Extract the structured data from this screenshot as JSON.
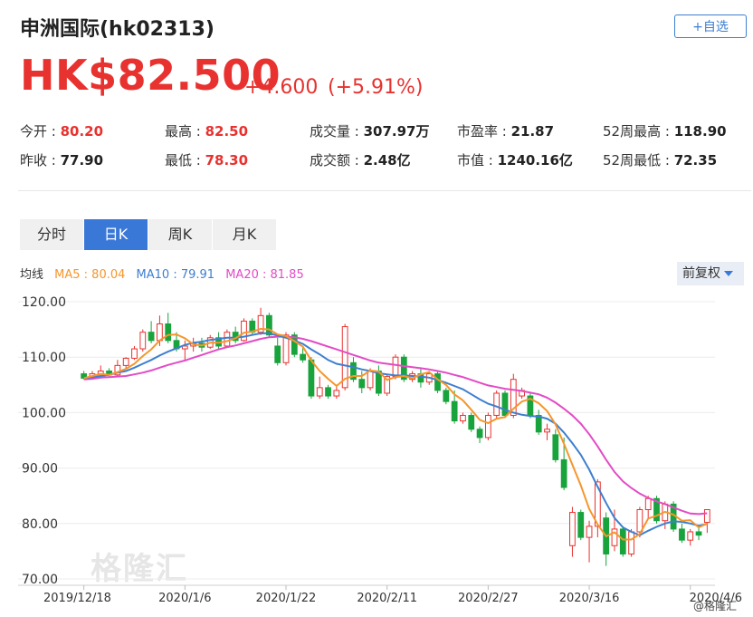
{
  "header": {
    "title": "申洲国际(hk02313)",
    "follow_label": "+自选",
    "price": "HK$82.500",
    "change": "+4.600",
    "change_pct": "(+5.91%)"
  },
  "stats": {
    "open": {
      "label": "今开 : ",
      "value": "80.20"
    },
    "high": {
      "label": "最高 : ",
      "value": "82.50"
    },
    "volume": {
      "label": "成交量 : ",
      "value": "307.97万"
    },
    "pe": {
      "label": "市盈率 : ",
      "value": "21.87"
    },
    "high52": {
      "label": "52周最高 : ",
      "value": "118.90"
    },
    "prev_close": {
      "label": "昨收 : ",
      "value": "77.90"
    },
    "low": {
      "label": "最低 : ",
      "value": "78.30"
    },
    "turnover": {
      "label": "成交额 : ",
      "value": "2.48亿"
    },
    "mkt_cap": {
      "label": "市值 : ",
      "value": "1240.16亿"
    },
    "low52": {
      "label": "52周最低 : ",
      "value": "72.35"
    }
  },
  "tabs": [
    "分时",
    "日K",
    "周K",
    "月K"
  ],
  "legend": {
    "label": "均线",
    "ma5": "MA5 : 80.04",
    "ma10": "MA10 : 79.91",
    "ma20": "MA20 : 81.85"
  },
  "adjust_label": "前复权",
  "watermark": "格隆汇",
  "credit": "@格隆汇",
  "colors": {
    "up": "#e8322f",
    "down": "#19a33c",
    "ma5": "#f5962b",
    "ma10": "#3d7fd0",
    "ma20": "#e24bc6",
    "accent": "#3a78d8"
  },
  "chart_data": {
    "type": "candlestick",
    "x_ticks": [
      "2019/12/18",
      "2020/1/6",
      "2020/1/22",
      "2020/2/11",
      "2020/2/27",
      "2020/3/16",
      "2020/4/6"
    ],
    "x_tick_index": [
      0,
      12,
      24,
      36,
      48,
      60,
      72
    ],
    "y_ticks": [
      "120.00",
      "110.00",
      "100.00",
      "90.00",
      "80.00",
      "70.00"
    ],
    "ylim": [
      70,
      120
    ],
    "candles": [
      [
        107,
        107.5,
        106,
        106.2
      ],
      [
        106.5,
        107.5,
        106,
        107.0
      ],
      [
        107.0,
        108.5,
        106.8,
        107.5
      ],
      [
        107.5,
        108.0,
        106.5,
        106.8
      ],
      [
        106.8,
        109.5,
        106.5,
        108.5
      ],
      [
        108.5,
        110.0,
        108.0,
        109.8
      ],
      [
        109.8,
        112.0,
        109.5,
        111.5
      ],
      [
        111.5,
        115.0,
        111.0,
        114.5
      ],
      [
        114.5,
        116.5,
        112.5,
        113.0
      ],
      [
        113.0,
        117.5,
        112.0,
        116.0
      ],
      [
        116.0,
        118.0,
        112.5,
        113.0
      ],
      [
        113.0,
        114.5,
        111.0,
        111.5
      ],
      [
        111.5,
        113.0,
        109.5,
        112.0
      ],
      [
        112.0,
        113.5,
        111.0,
        112.5
      ],
      [
        112.5,
        113.5,
        111.0,
        111.8
      ],
      [
        111.8,
        114.0,
        111.5,
        113.5
      ],
      [
        113.5,
        114.5,
        111.5,
        112.0
      ],
      [
        112.0,
        115.0,
        111.8,
        114.5
      ],
      [
        114.5,
        115.5,
        112.5,
        113.0
      ],
      [
        113.0,
        117.0,
        112.8,
        116.5
      ],
      [
        116.5,
        117.0,
        114.0,
        114.5
      ],
      [
        114.5,
        118.9,
        114.0,
        117.5
      ],
      [
        117.5,
        118.0,
        113.5,
        114.0
      ],
      [
        112.0,
        113.5,
        108.5,
        109.0
      ],
      [
        109.0,
        114.5,
        108.5,
        114.0
      ],
      [
        114.0,
        114.5,
        110.0,
        110.5
      ],
      [
        110.5,
        112.0,
        109.0,
        109.5
      ],
      [
        109.5,
        110.0,
        102.5,
        103.0
      ],
      [
        103.0,
        106.5,
        102.5,
        104.5
      ],
      [
        104.5,
        105.0,
        102.5,
        103.0
      ],
      [
        103.0,
        105.0,
        102.5,
        104.0
      ],
      [
        104.5,
        116.0,
        104.0,
        115.5
      ],
      [
        109.0,
        110.0,
        105.5,
        106.0
      ],
      [
        106.0,
        107.5,
        103.5,
        104.5
      ],
      [
        104.5,
        108.0,
        104.0,
        107.5
      ],
      [
        107.5,
        108.5,
        103.0,
        103.5
      ],
      [
        103.5,
        107.0,
        103.0,
        106.5
      ],
      [
        106.5,
        110.5,
        106.0,
        110.0
      ],
      [
        110.0,
        110.5,
        105.5,
        106.0
      ],
      [
        106.0,
        107.5,
        105.5,
        107.0
      ],
      [
        107.0,
        108.0,
        104.5,
        105.5
      ],
      [
        105.5,
        107.5,
        105.0,
        107.0
      ],
      [
        107.0,
        107.5,
        103.5,
        104.0
      ],
      [
        104.0,
        104.5,
        101.5,
        102.0
      ],
      [
        102.0,
        104.0,
        98.0,
        98.5
      ],
      [
        98.5,
        100.0,
        98.0,
        99.5
      ],
      [
        99.5,
        100.0,
        96.5,
        97.0
      ],
      [
        97.0,
        97.5,
        94.5,
        95.5
      ],
      [
        95.5,
        100.0,
        95.0,
        99.5
      ],
      [
        99.5,
        104.0,
        99.0,
        103.5
      ],
      [
        103.5,
        104.0,
        99.0,
        99.5
      ],
      [
        99.5,
        107.0,
        99.0,
        106.0
      ],
      [
        103.0,
        104.5,
        102.5,
        104.0
      ],
      [
        103.0,
        103.5,
        99.0,
        99.5
      ],
      [
        99.5,
        100.5,
        96.0,
        96.5
      ],
      [
        96.5,
        98.0,
        95.0,
        97.0
      ],
      [
        96.0,
        97.0,
        91.0,
        91.5
      ],
      [
        91.5,
        95.5,
        86.0,
        86.5
      ],
      [
        76.0,
        83.0,
        74.0,
        82.0
      ],
      [
        82.0,
        82.5,
        77.0,
        77.5
      ],
      [
        77.5,
        80.5,
        73.0,
        79.5
      ],
      [
        79.5,
        88.0,
        77.5,
        87.5
      ],
      [
        81.0,
        82.0,
        72.35,
        74.5
      ],
      [
        76.0,
        82.5,
        75.0,
        79.0
      ],
      [
        79.0,
        79.5,
        74.0,
        74.5
      ],
      [
        74.5,
        79.0,
        74.0,
        78.5
      ],
      [
        78.5,
        83.0,
        77.5,
        82.5
      ],
      [
        82.5,
        85.0,
        81.0,
        84.5
      ],
      [
        84.5,
        85.0,
        80.0,
        80.5
      ],
      [
        80.5,
        84.0,
        79.0,
        83.5
      ],
      [
        83.5,
        84.0,
        78.5,
        79.0
      ],
      [
        79.0,
        80.0,
        76.5,
        77.0
      ],
      [
        77.0,
        79.0,
        76.0,
        78.5
      ],
      [
        78.5,
        79.5,
        77.0,
        77.9
      ],
      [
        80.2,
        82.5,
        78.3,
        82.5
      ]
    ],
    "ma5": [
      106.2,
      106.6,
      107.0,
      106.8,
      107.3,
      107.9,
      108.8,
      110.2,
      111.4,
      113.0,
      114.0,
      114.1,
      113.4,
      112.3,
      112.1,
      112.6,
      112.6,
      112.9,
      113.4,
      114.4,
      114.6,
      115.1,
      115.0,
      114.1,
      113.8,
      112.9,
      111.9,
      109.4,
      107.5,
      106.1,
      104.8,
      106.1,
      106.6,
      106.6,
      107.6,
      107.4,
      105.9,
      106.4,
      106.6,
      106.2,
      106.9,
      107.3,
      106.0,
      105.0,
      103.3,
      102.2,
      100.5,
      98.7,
      98.1,
      98.9,
      99.2,
      100.7,
      102.0,
      102.5,
      101.7,
      100.3,
      97.9,
      94.4,
      90.6,
      86.9,
      82.6,
      79.8,
      77.7,
      78.4,
      77.1,
      77.1,
      78.1,
      80.9,
      81.4,
      82.1,
      81.6,
      80.5,
      80.6,
      79.3,
      80.0
    ],
    "ma10": [
      106.2,
      106.4,
      106.6,
      106.8,
      107.2,
      107.5,
      108.1,
      108.8,
      109.5,
      110.3,
      111.0,
      111.6,
      112.2,
      112.6,
      112.8,
      113.1,
      113.3,
      113.5,
      113.5,
      113.7,
      114.0,
      114.3,
      114.3,
      113.9,
      113.5,
      113.0,
      112.4,
      111.4,
      110.5,
      109.5,
      108.8,
      108.5,
      108.2,
      107.8,
      107.5,
      107.1,
      106.9,
      106.7,
      106.7,
      106.6,
      106.5,
      106.3,
      105.9,
      105.4,
      104.8,
      104.2,
      103.3,
      102.4,
      101.6,
      101.1,
      100.5,
      100.0,
      99.6,
      99.4,
      99.3,
      98.9,
      98.0,
      96.4,
      94.5,
      92.4,
      89.7,
      86.6,
      83.7,
      81.0,
      79.3,
      78.5,
      77.9,
      78.7,
      79.4,
      80.0,
      80.4,
      80.3,
      80.0,
      79.6,
      79.9
    ],
    "ma20": [
      106.0,
      106.1,
      106.3,
      106.4,
      106.5,
      106.6,
      106.9,
      107.2,
      107.6,
      108.1,
      108.6,
      109.0,
      109.4,
      109.9,
      110.4,
      110.9,
      111.4,
      111.8,
      112.1,
      112.5,
      112.9,
      113.3,
      113.6,
      113.7,
      113.7,
      113.6,
      113.3,
      112.9,
      112.4,
      111.9,
      111.4,
      110.9,
      110.4,
      109.9,
      109.4,
      109.0,
      108.8,
      108.6,
      108.4,
      108.2,
      108.0,
      107.8,
      107.5,
      107.2,
      106.8,
      106.4,
      105.9,
      105.4,
      104.9,
      104.6,
      104.3,
      104.1,
      103.9,
      103.6,
      103.3,
      102.7,
      101.8,
      100.7,
      99.5,
      98.0,
      96.1,
      93.9,
      91.5,
      89.3,
      87.6,
      86.4,
      85.4,
      84.6,
      84.0,
      83.5,
      82.9,
      82.3,
      81.8,
      81.7,
      81.85
    ]
  }
}
